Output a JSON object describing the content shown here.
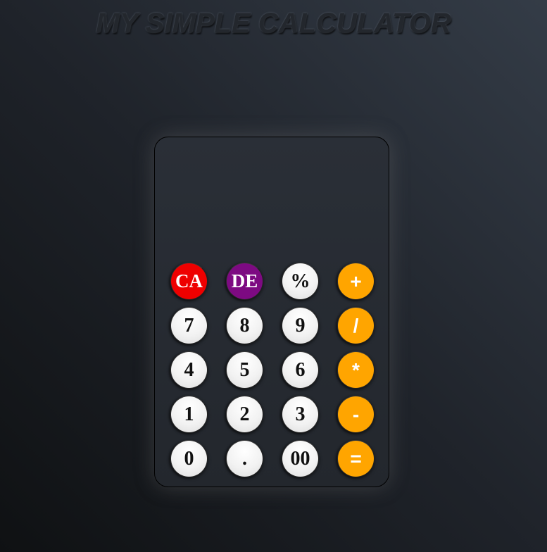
{
  "header": {
    "title": "MY SIMPLE CALCULATOR"
  },
  "calculator": {
    "display_value": "",
    "keys": {
      "clear_all": "CA",
      "delete": "DE",
      "percent": "%",
      "plus": "+",
      "seven": "7",
      "eight": "8",
      "nine": "9",
      "divide": "/",
      "four": "4",
      "five": "5",
      "six": "6",
      "multiply": "*",
      "one": "1",
      "two": "2",
      "three": "3",
      "minus": "-",
      "zero": "0",
      "decimal": ".",
      "double_zero": "00",
      "equals": "="
    }
  },
  "colors": {
    "clear_all": "#ee0000",
    "delete": "#7d0a82",
    "operator": "#ffa500",
    "digit": "#f2f2f2"
  }
}
